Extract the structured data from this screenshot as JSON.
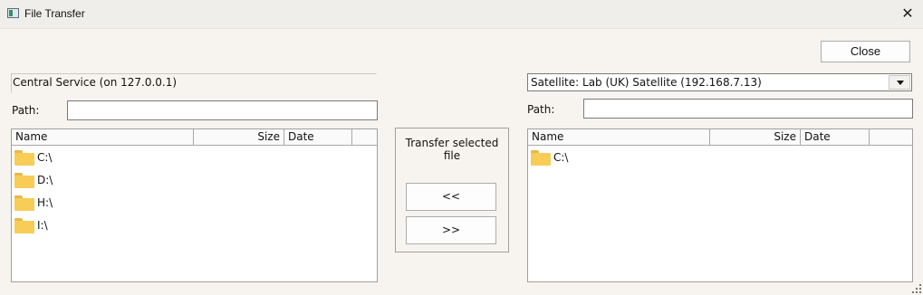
{
  "window": {
    "title": "File Transfer",
    "app_icon": "file-transfer-app-icon",
    "close_glyph": "✕"
  },
  "toolbar": {
    "close_label": "Close"
  },
  "left": {
    "service_label": "Central Service (on 127.0.0.1)",
    "path_label": "Path:",
    "path_value": "",
    "columns": [
      "Name",
      "Size",
      "Date"
    ],
    "items": [
      {
        "icon": "folder-icon",
        "label": "C:\\"
      },
      {
        "icon": "folder-icon",
        "label": "D:\\"
      },
      {
        "icon": "folder-icon",
        "label": "H:\\"
      },
      {
        "icon": "folder-icon",
        "label": "I:\\"
      }
    ]
  },
  "transfer": {
    "heading_line1": "Transfer selected",
    "heading_line2": "file",
    "to_left_label": "<<",
    "to_right_label": ">>"
  },
  "right": {
    "satellite_selected": "Satellite: Lab (UK) Satellite (192.168.7.13)",
    "path_label": "Path:",
    "path_value": "",
    "columns": [
      "Name",
      "Size",
      "Date"
    ],
    "items": [
      {
        "icon": "folder-icon",
        "label": "C:\\"
      }
    ]
  },
  "colors": {
    "window_bg": "#f7f3ee",
    "titlebar_bg": "#f0eeeb",
    "folder": "#f7cc57"
  }
}
